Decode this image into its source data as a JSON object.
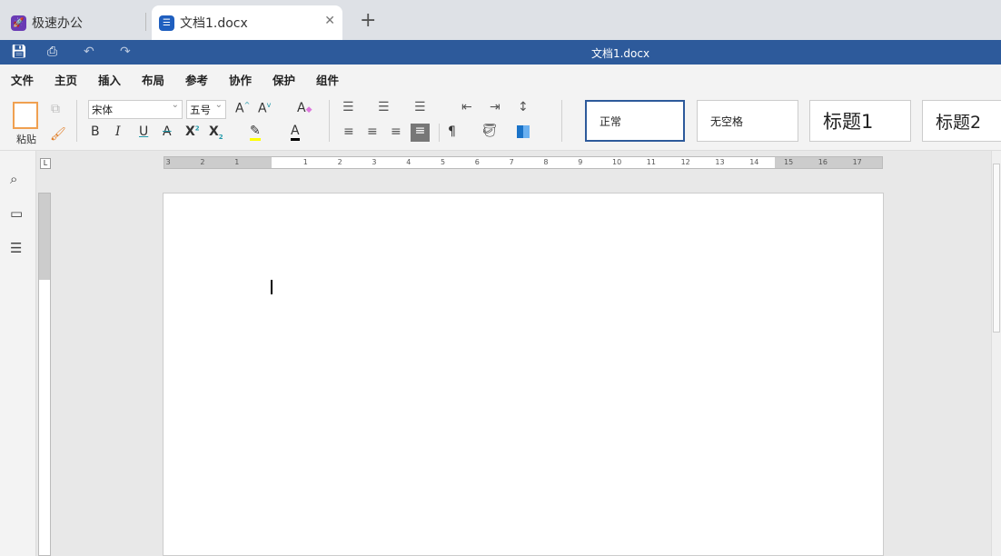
{
  "tabs": [
    {
      "label": "极速办公",
      "icon": "rocket-icon",
      "color": "#6a3bb5"
    },
    {
      "label": "文档1.docx",
      "icon": "document-icon",
      "color": "#1f5fbf"
    }
  ],
  "window_title": "文档1.docx",
  "menu": [
    "文件",
    "主页",
    "插入",
    "布局",
    "参考",
    "协作",
    "保护",
    "组件"
  ],
  "active_menu": "主页",
  "toolbar": {
    "paste": "粘贴",
    "font_name": "宋体",
    "font_size": "五号"
  },
  "styles": [
    "正常",
    "无空格",
    "标题1",
    "标题2"
  ],
  "ruler": {
    "left": [
      "3",
      "2",
      "1"
    ],
    "right": [
      "1",
      "2",
      "3",
      "4",
      "5",
      "6",
      "7",
      "8",
      "9",
      "10",
      "11",
      "12",
      "13",
      "14",
      "15",
      "16",
      "17"
    ]
  },
  "colors": {
    "accent": "#2d5a9b",
    "highlight": "#ffff00",
    "font_color": "#000000"
  }
}
